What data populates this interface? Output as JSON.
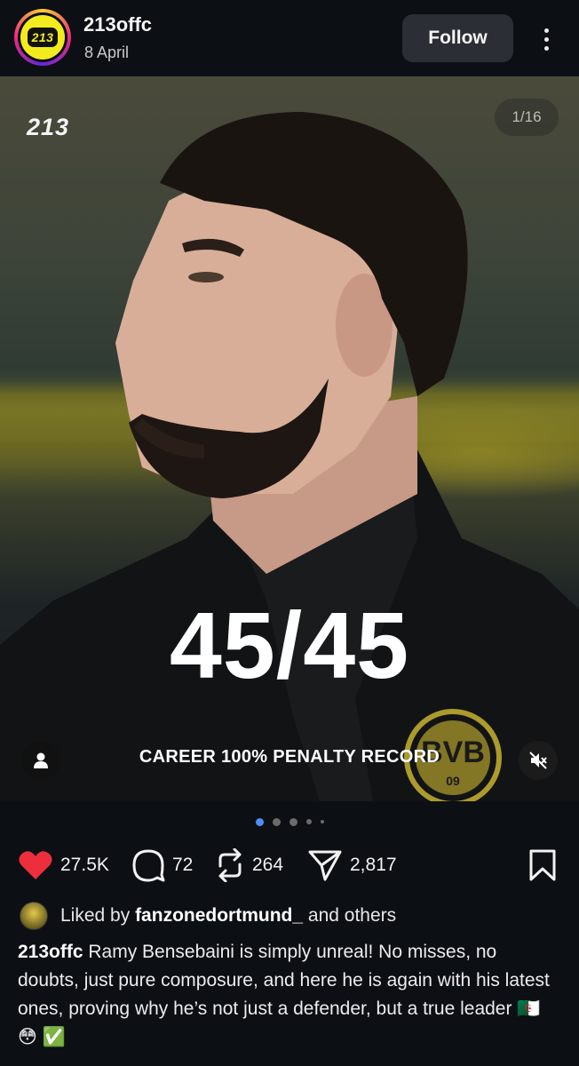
{
  "header": {
    "avatar_text": "213",
    "username": "213offc",
    "date": "8 April",
    "follow_label": "Follow"
  },
  "media": {
    "brand_mark": "213",
    "counter": "1/16",
    "big_stat": "45/45",
    "caption": "CAREER 100% PENALTY RECORD",
    "crest_text_top": "BVB",
    "crest_text_bottom": "09"
  },
  "carousel": {
    "total_dots_visible": 5,
    "active_index": 0
  },
  "actions": {
    "likes": "27.5K",
    "comments": "72",
    "reposts": "264",
    "shares": "2,817"
  },
  "liked_by": {
    "prefix": "Liked by",
    "user": "fanzonedortmund_",
    "suffix": "and others"
  },
  "post_caption": {
    "author": "213offc",
    "text": "Ramy Bensebaini is simply unreal! No misses, no doubts, just pure composure, and here he is again with his latest ones, proving why he’s not just a defender, but a true leader 🇩🇿 😳 ✅"
  },
  "colors": {
    "background": "#0c0f14",
    "like_red": "#ed2f3d",
    "dot_active": "#4f8ef7",
    "avatar_yellow": "#f2ec1e"
  },
  "icons": [
    "more-vertical-icon",
    "user-tag-icon",
    "mute-icon",
    "heart-icon",
    "comment-icon",
    "repost-icon",
    "share-icon",
    "bookmark-icon"
  ]
}
